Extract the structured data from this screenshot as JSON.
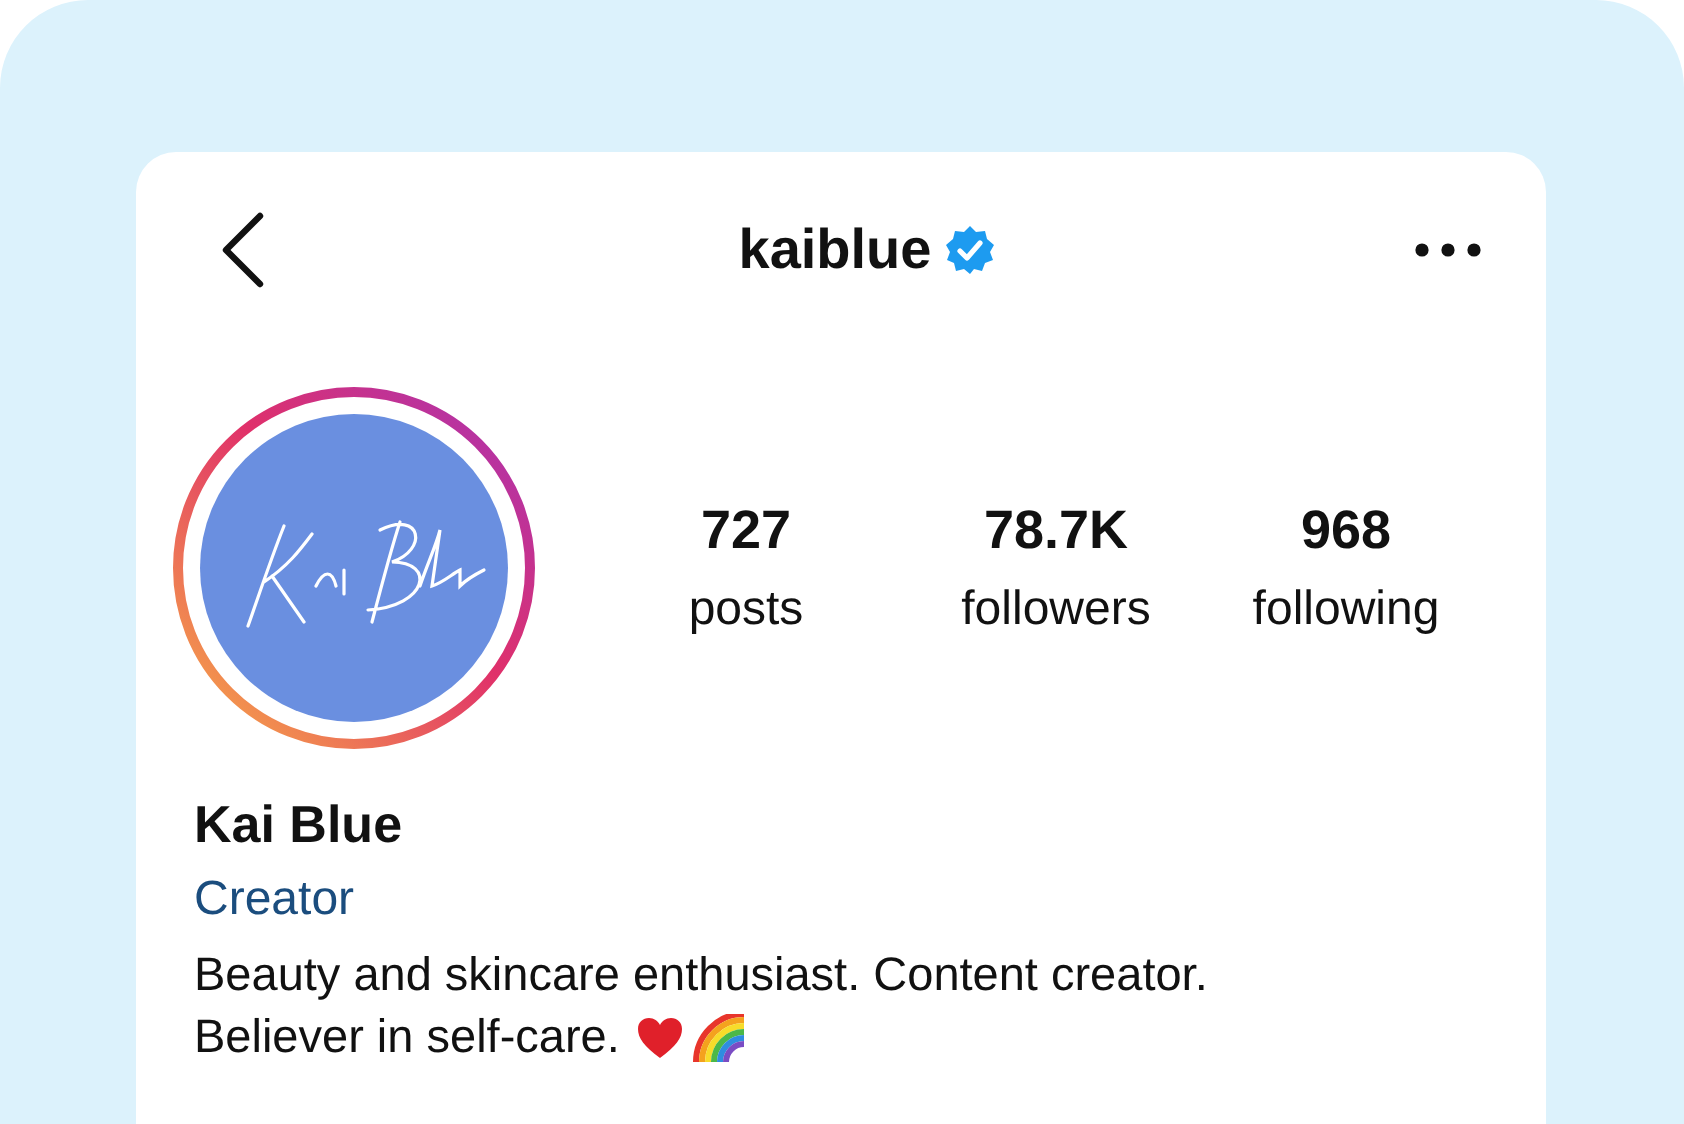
{
  "header": {
    "username": "kaiblue",
    "verified": true
  },
  "profile": {
    "avatar": {
      "kind": "picture",
      "story_ring": true
    }
  },
  "stats": [
    {
      "value": "727",
      "label": "posts"
    },
    {
      "value": "78.7K",
      "label": "followers"
    },
    {
      "value": "968",
      "label": "following"
    }
  ],
  "bio": {
    "name": "Kai Blue",
    "category": "Creator",
    "lines": [
      "Beauty and skincare enthusiast. Content creator.",
      "Believer in self-care."
    ],
    "emoji_icons": [
      {
        "kind": "heart"
      },
      {
        "kind": "rainbow"
      }
    ]
  }
}
